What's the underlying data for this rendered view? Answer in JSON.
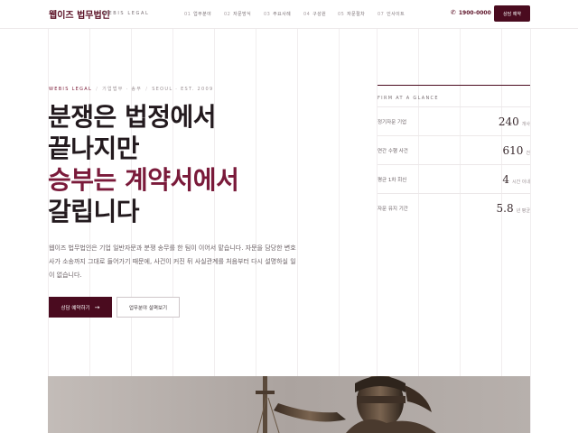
{
  "header": {
    "logo": "웹이즈 법무법인",
    "logo_sub": "WEBIS LEGAL",
    "nav": [
      {
        "num": "01",
        "label": "업무분야"
      },
      {
        "num": "02",
        "label": "자문방식"
      },
      {
        "num": "03",
        "label": "주요사례"
      },
      {
        "num": "04",
        "label": "구성원"
      },
      {
        "num": "05",
        "label": "자문절차"
      },
      {
        "num": "07",
        "label": "인사이트"
      }
    ],
    "phone": "1900-0000",
    "cta": "상담 예약"
  },
  "hero": {
    "breadcrumb": {
      "brand": "WEBIS LEGAL",
      "item1": "기업법무 · 송무",
      "item2": "SEOUL · EST. 2009"
    },
    "headline": {
      "line1": "분쟁은 법정에서",
      "line2": "끝나지만",
      "line3": "승부는 계약서에서",
      "line4": "갈립니다"
    },
    "description": "웹이즈 법무법인은 기업 일반자문과 분쟁 송무를 한 팀이 이어서 맡습니다. 자문을 담당한 변호사가 소송까지 그대로 들어가기 때문에, 사건이 커진 뒤 사실관계를 처음부터 다시 설명하실 일이 없습니다.",
    "primary_button": "상담 예약하기",
    "secondary_button": "업무분야 살펴보기"
  },
  "panel": {
    "title": "FIRM AT A GLANCE",
    "stats": [
      {
        "label": "정기자문 기업",
        "value": "240",
        "unit": "개사"
      },
      {
        "label": "연간 수행 사건",
        "value": "610",
        "unit": "건"
      },
      {
        "label": "평균 1차 회신",
        "value": "4",
        "unit": "시간 이내"
      },
      {
        "label": "자문 유지 기간",
        "value": "5.8",
        "unit": "년 평균"
      }
    ]
  },
  "colors": {
    "brand": "#4a0b1f",
    "accent": "#7a1a3a"
  },
  "icons": {
    "phone": "phone-icon",
    "arrow": "arrow-right-icon"
  }
}
